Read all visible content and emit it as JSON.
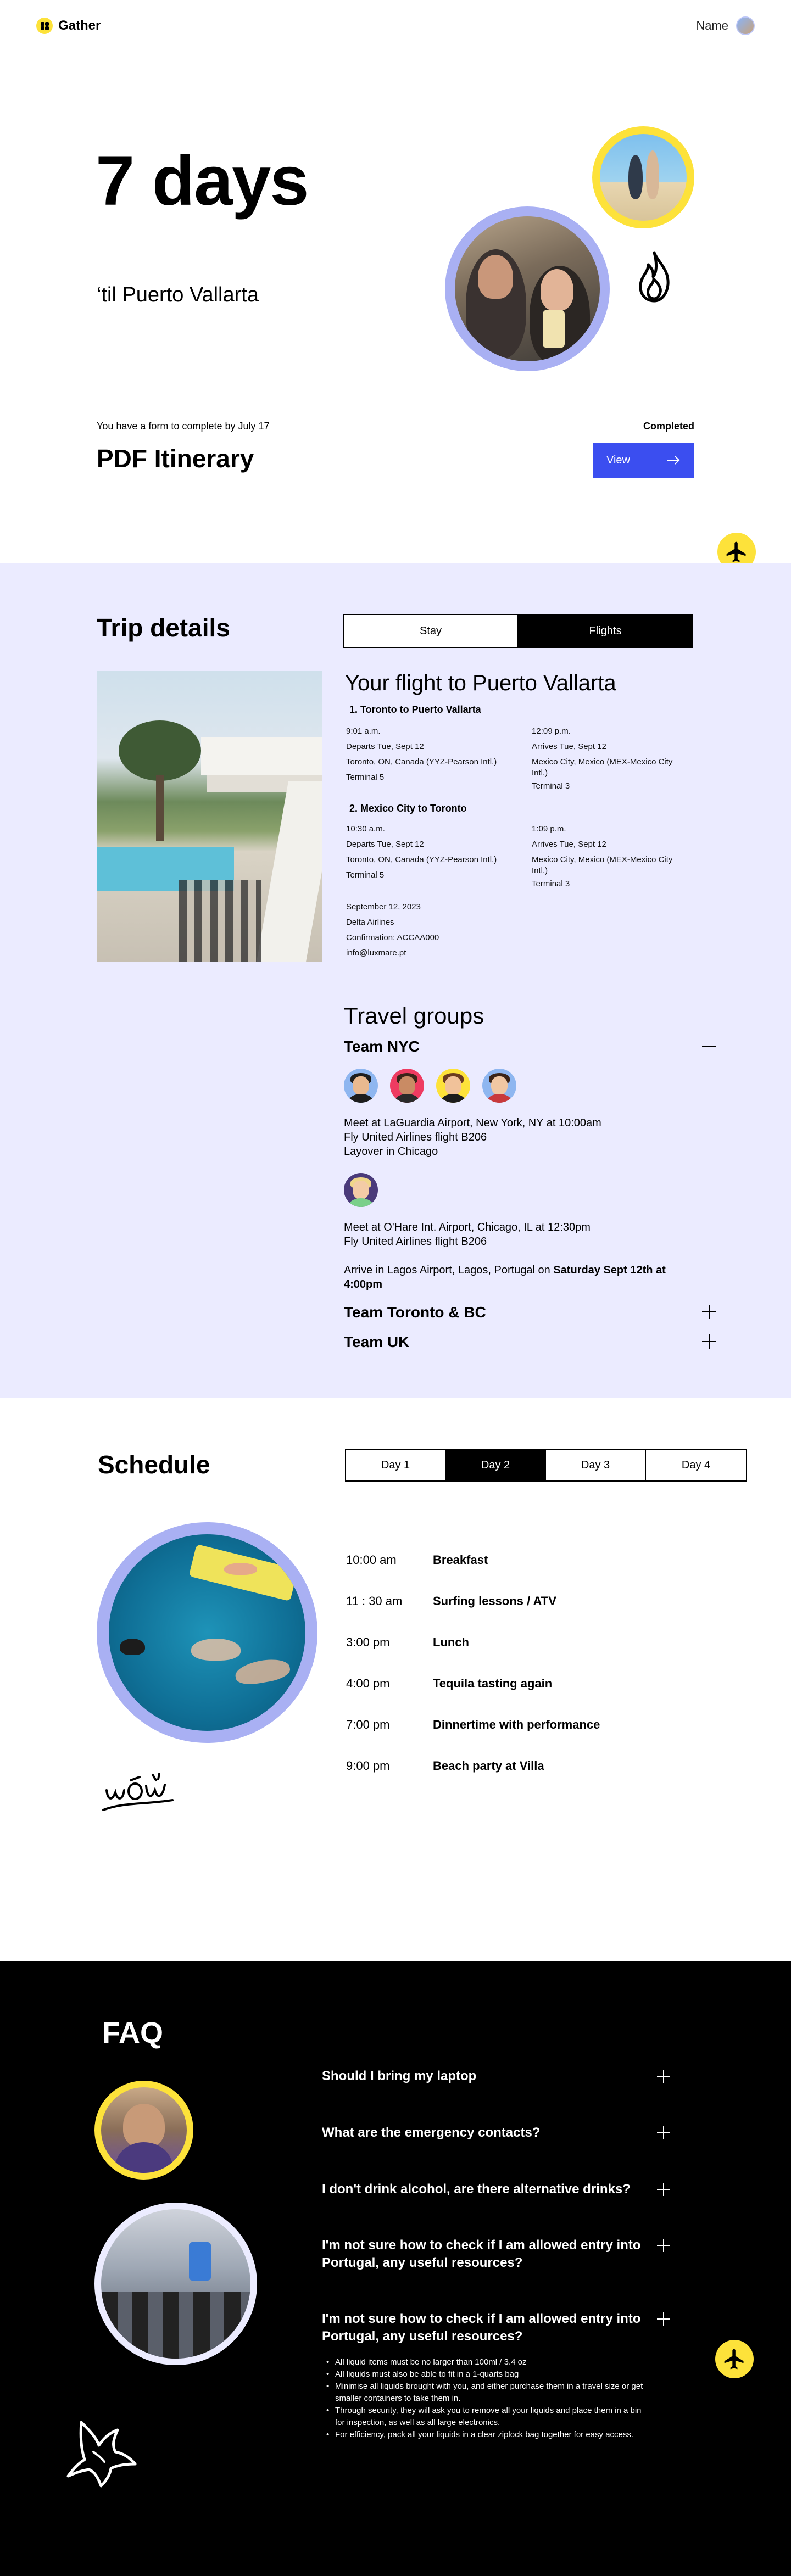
{
  "header": {
    "brand": "Gather",
    "user_name": "Name"
  },
  "hero": {
    "countdown": "7 days",
    "destination": "‘til Puerto Vallarta",
    "form_note": "You have a form to complete by July 17",
    "form_title": "PDF Itinerary",
    "status": "Completed",
    "view_label": "View"
  },
  "trip": {
    "title": "Trip details",
    "tabs": [
      {
        "label": "Stay",
        "active": false
      },
      {
        "label": "Flights",
        "active": true
      }
    ],
    "flight_title": "Your flight to Puerto Vallarta",
    "legs": [
      {
        "title": "1. Toronto to Puerto Vallarta",
        "depart": {
          "time": "9:01 a.m.",
          "date": "Departs Tue, Sept 12",
          "place": "Toronto, ON, Canada (YYZ-Pearson Intl.)",
          "terminal": "Terminal 5"
        },
        "arrive": {
          "time": "12:09 p.m.",
          "date": "Arrives Tue, Sept 12",
          "place_1": "Mexico City, Mexico (MEX-Mexico City",
          "place_2": "Intl.)",
          "terminal": "Terminal 3"
        }
      },
      {
        "title": "2. Mexico City to Toronto",
        "depart": {
          "time": "10:30 a.m.",
          "date": "Departs Tue, Sept 12",
          "place": "Toronto, ON, Canada (YYZ-Pearson Intl.)",
          "terminal": "Terminal 5"
        },
        "arrive": {
          "time": "1:09 p.m.",
          "date": "Arrives Tue, Sept 12",
          "place_1": "Mexico City, Mexico (MEX-Mexico City",
          "place_2": "Intl.)",
          "terminal": "Terminal 3"
        }
      }
    ],
    "booking": {
      "date": "September 12, 2023",
      "airline": "Delta Airlines",
      "confirmation": "Confirmation: ACCAA000",
      "email": "info@luxmare.pt"
    },
    "groups_title": "Travel groups",
    "groups": [
      {
        "name": "Team NYC",
        "expanded": true,
        "meet_1": [
          "Meet at LaGuardia Airport, New York, NY at 10:00am",
          "Fly United Airlines flight B206",
          "Layover in Chicago"
        ],
        "meet_2": [
          "Meet at O'Hare Int. Airport, Chicago, IL at 12:30pm",
          "Fly United Airlines flight B206"
        ],
        "arrive_prefix": "Arrive in Lagos Airport, Lagos, Portugal on ",
        "arrive_bold_1": "Saturday Sept 12th at",
        "arrive_bold_2": "4:00pm"
      },
      {
        "name": "Team Toronto & BC",
        "expanded": false
      },
      {
        "name": "Team UK",
        "expanded": false
      }
    ]
  },
  "schedule": {
    "title": "Schedule",
    "days": [
      {
        "label": "Day 1",
        "active": false
      },
      {
        "label": "Day 2",
        "active": true
      },
      {
        "label": "Day 3",
        "active": false
      },
      {
        "label": "Day 4",
        "active": false
      }
    ],
    "items": [
      {
        "time": "10:00 am",
        "event": "Breakfast"
      },
      {
        "time": "11 : 30 am",
        "event": "Surfing lessons / ATV"
      },
      {
        "time": "3:00 pm",
        "event": "Lunch"
      },
      {
        "time": "4:00 pm",
        "event": "Tequila tasting again"
      },
      {
        "time": "7:00 pm",
        "event": "Dinnertime with performance"
      },
      {
        "time": "9:00 pm",
        "event": "Beach party at Villa"
      }
    ]
  },
  "faq": {
    "title": "FAQ",
    "questions": [
      {
        "q1": "Should I bring my laptop",
        "q2": ""
      },
      {
        "q1": "What are the emergency contacts?",
        "q2": ""
      },
      {
        "q1": "I don't drink alcohol, are there alternative drinks?",
        "q2": ""
      },
      {
        "q1": "I'm not sure how to check if I am allowed entry into",
        "q2": "Portugal, any useful resources?"
      },
      {
        "q1": "I'm not sure how to check if I am allowed entry into",
        "q2": "Portugal, any useful resources?"
      }
    ],
    "answer": [
      "All liquid items must be no larger than 100ml / 3.4 oz",
      "All liquids must also be able to fit in a 1-quarts bag",
      "Minimise all liquids brought with you, and either purchase them in a travel size or get",
      "smaller containers to take them in.",
      "Through security, they will ask you to remove all your liquids and place them in a bin",
      "for inspection, as well as all large electronics.",
      "For efficiency, pack all your liquids in a clear ziplock bag together for easy access."
    ]
  },
  "colors": {
    "accent": "#3b4ef0",
    "yellow": "#fde23a",
    "lavender": "#ebebff",
    "ring": "#a9b0f3"
  }
}
